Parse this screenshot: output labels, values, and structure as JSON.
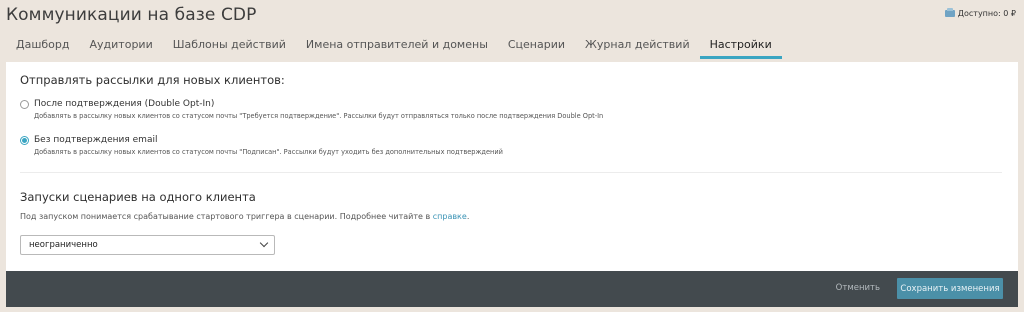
{
  "header": {
    "title": "Коммуникации на базе CDP",
    "balance": "Доступно: 0 ₽"
  },
  "tabs": [
    {
      "label": "Дашборд",
      "active": false
    },
    {
      "label": "Аудитории",
      "active": false
    },
    {
      "label": "Шаблоны действий",
      "active": false
    },
    {
      "label": "Имена отправителей и домены",
      "active": false
    },
    {
      "label": "Сценарии",
      "active": false
    },
    {
      "label": "Журнал действий",
      "active": false
    },
    {
      "label": "Настройки",
      "active": true
    }
  ],
  "send_section": {
    "title": "Отправлять рассылки для новых клиентов:",
    "options": [
      {
        "label": "После подтверждения (Double Opt-In)",
        "description": "Добавлять в рассылку новых клиентов со статусом почты \"Требуется подтверждение\". Рассылки будут отправляться только после подтверждения Double Opt-In",
        "checked": false
      },
      {
        "label": "Без подтверждения email",
        "description": "Добавлять в рассылку новых клиентов со статусом почты \"Подписан\". Рассылки будут уходить без дополнительных подтверждений",
        "checked": true
      }
    ]
  },
  "launch_section": {
    "title": "Запуски сценариев на одного клиента",
    "help_text": "Под запуском понимается срабатывание стартового триггера в сценарии. Подробнее читайте в ",
    "help_link": "справке",
    "help_suffix": ".",
    "select_value": "неограниченно"
  },
  "footer": {
    "cancel_label": "Отменить",
    "save_label": "Сохранить изменения"
  },
  "colors": {
    "accent": "#3aa5c2",
    "footer_bg": "#434a4e",
    "save_bg": "#4b90a8",
    "page_bg": "#ece5dd"
  }
}
